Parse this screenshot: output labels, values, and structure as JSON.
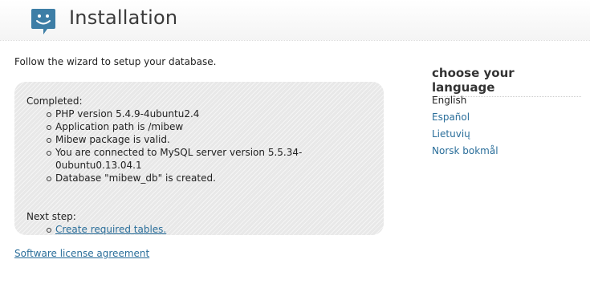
{
  "header": {
    "title": "Installation",
    "logo_icon": "speech-bubble-smiley-icon",
    "logo_color": "#3d7ea6"
  },
  "main": {
    "intro": "Follow the wizard to setup your database.",
    "completed_label": "Completed:",
    "completed_items": [
      "PHP version 5.4.9-4ubuntu2.4",
      "Application path is /mibew",
      "Mibew package is valid.",
      "You are connected to MySQL server version 5.5.34-0ubuntu0.13.04.1",
      "Database \"mibew_db\" is created."
    ],
    "next_step_label": "Next step:",
    "next_step_link": "Create required tables.",
    "license_link": "Software license agreement"
  },
  "sidebar": {
    "title": "choose your language",
    "current_language": "English",
    "languages": [
      "Español",
      "Lietuvių",
      "Norsk bokmål"
    ]
  },
  "colors": {
    "link": "#2a6e9a",
    "panel_background": "#e8e8e8"
  }
}
